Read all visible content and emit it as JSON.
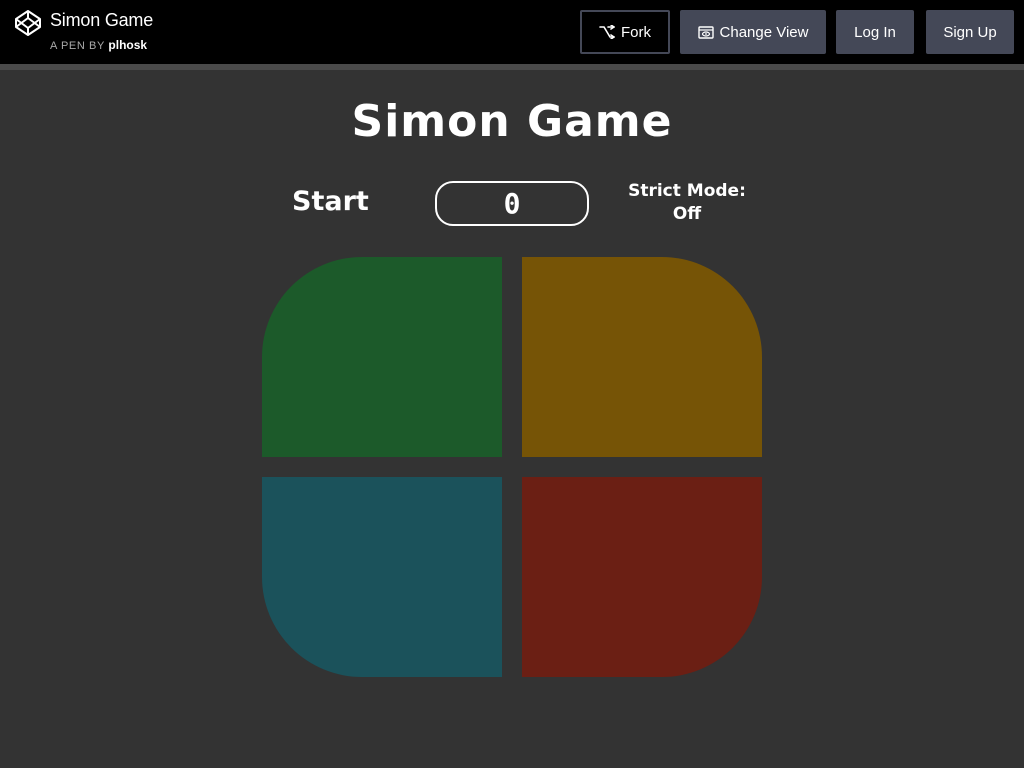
{
  "header": {
    "pen_title": "Simon Game",
    "pen_by_prefix": "A PEN BY",
    "author": "plhosk",
    "fork_label": "Fork",
    "change_view_label": "Change View",
    "login_label": "Log In",
    "signup_label": "Sign Up"
  },
  "game": {
    "title": "Simon Game",
    "start_label": "Start",
    "count": "0",
    "strict_label": "Strict Mode:",
    "strict_value": "Off"
  },
  "pads": {
    "green": "#1c5a2a",
    "yellow": "#765406",
    "blue": "#1b525b",
    "red": "#6b1f14"
  },
  "icons": {
    "logo": "codepen-logo-icon",
    "fork": "fork-icon",
    "change_view": "eye-icon"
  }
}
